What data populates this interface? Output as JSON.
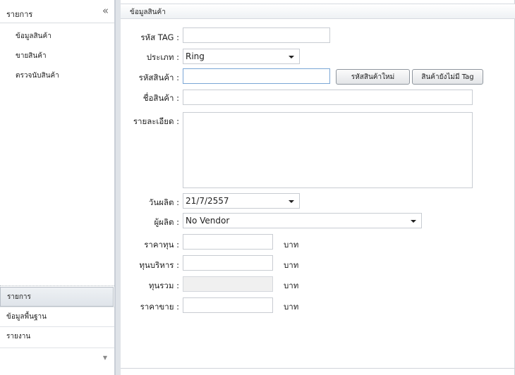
{
  "sidebar": {
    "title": "รายการ",
    "collapse_glyph": "«",
    "items": [
      {
        "label": "ข้อมูลสินค้า"
      },
      {
        "label": "ขายสินค้า"
      },
      {
        "label": "ตรวจนับสินค้า"
      }
    ],
    "nav_sections": [
      {
        "label": "รายการ",
        "active": true
      },
      {
        "label": "ข้อมูลพื้นฐาน",
        "active": false
      },
      {
        "label": "รายงาน",
        "active": false
      }
    ],
    "footer_glyph": "▼"
  },
  "panel": {
    "title": "ข้อมูลสินค้า"
  },
  "form": {
    "tag": {
      "label": "รหัส TAG :",
      "value": ""
    },
    "type": {
      "label": "ประเภท :",
      "value": "Ring"
    },
    "product_code": {
      "label": "รหัสสินค้า :",
      "value": ""
    },
    "new_code_button": "รหัสสินค้าใหม่",
    "no_tag_button": "สินค้ายังไม่มี Tag",
    "product_name": {
      "label": "ชื่อสินค้า :",
      "value": ""
    },
    "details": {
      "label": "รายละเอียด :",
      "value": ""
    },
    "production_date": {
      "label": "วันผลิต :",
      "value": "21/7/2557"
    },
    "vendor": {
      "label": "ผู้ผลิต :",
      "value": "No Vendor"
    },
    "cost_price": {
      "label": "ราคาทุน :",
      "value": "",
      "unit": "บาท"
    },
    "admin_cost": {
      "label": "ทุนบริหาร :",
      "value": "",
      "unit": "บาท"
    },
    "total_cost": {
      "label": "ทุนรวม :",
      "value": "",
      "unit": "บาท"
    },
    "sale_price": {
      "label": "ราคาขาย :",
      "value": "",
      "unit": "บาท"
    }
  }
}
